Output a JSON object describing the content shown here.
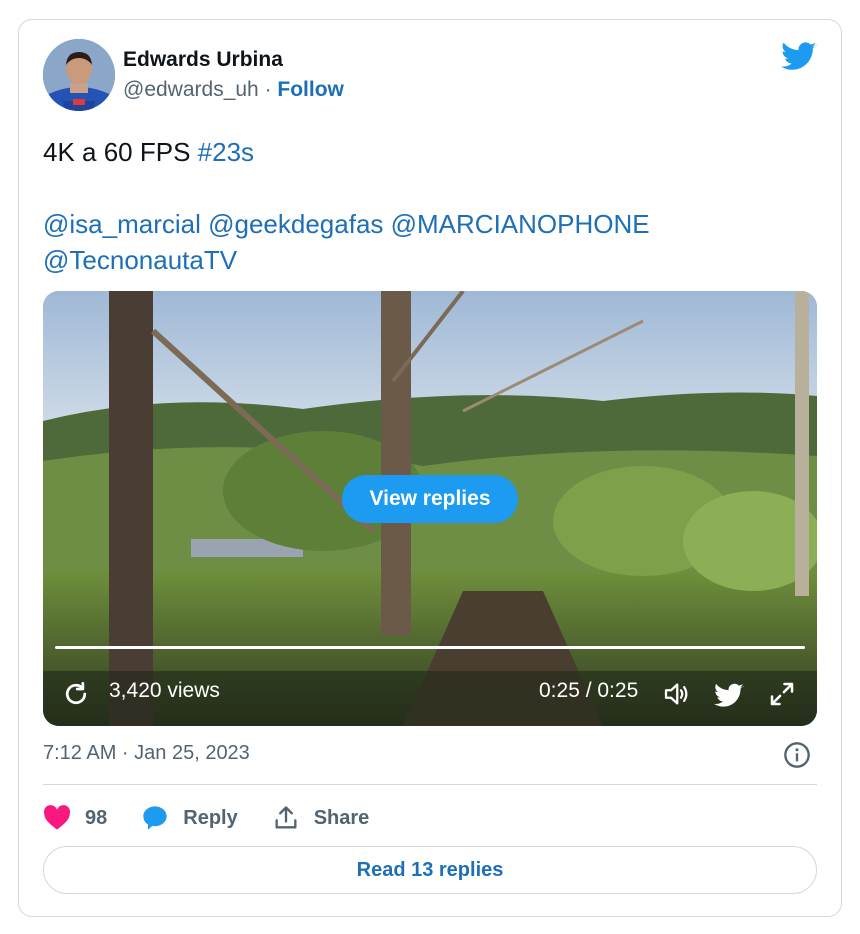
{
  "author": {
    "display_name": "Edwards Urbina",
    "handle": "@edwards_uh",
    "separator": " · ",
    "follow_label": "Follow",
    "avatar_icon": "user-avatar"
  },
  "brand_icon": "twitter-bird-icon",
  "tweet": {
    "text_prefix": "4K a 60 FPS ",
    "hashtag": "#23s",
    "mentions_line1": "@isa_marcial @geekdegafas @MARCIANOPHONE",
    "mentions_line2": "@TecnonautaTV"
  },
  "video": {
    "view_replies_label": "View replies",
    "views": "3,420 views",
    "time": "0:25 / 0:25",
    "progress": 1.0,
    "icons": [
      "replay-icon",
      "volume-icon",
      "twitter-bird-icon",
      "expand-icon"
    ]
  },
  "timestamp": "7:12 AM · Jan 25, 2023",
  "actions": {
    "likes": "98",
    "reply_label": "Reply",
    "share_label": "Share"
  },
  "read_replies_label": "Read 13 replies",
  "colors": {
    "link": "#1d6fb8",
    "like": "#f91880",
    "reply_icon": "#1d9bf0",
    "muted": "#536471",
    "view_replies_bg": "#1d9bf0"
  }
}
